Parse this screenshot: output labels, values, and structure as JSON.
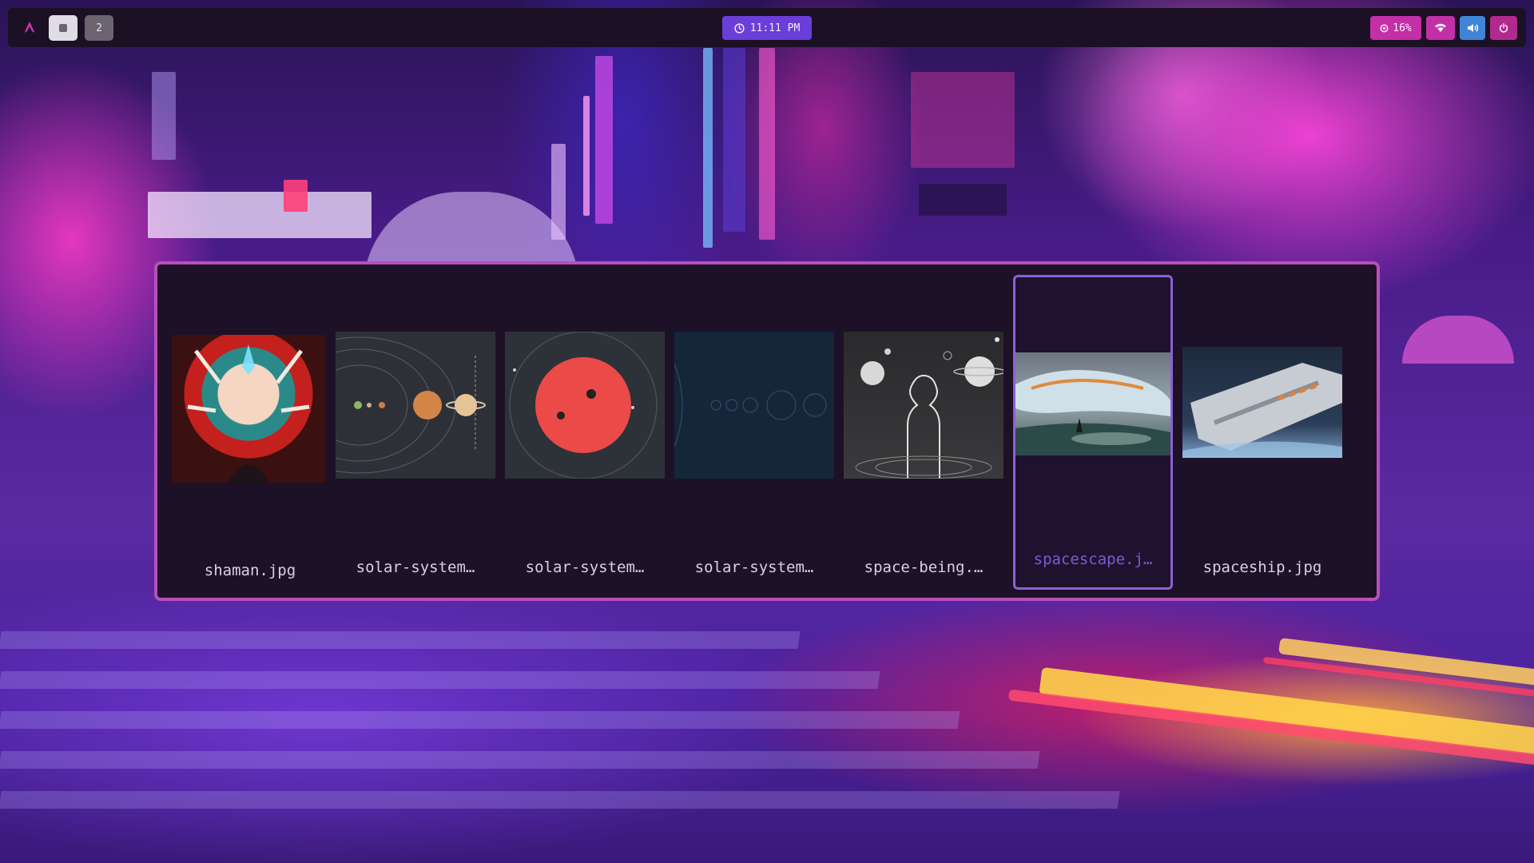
{
  "topbar": {
    "logo_icon": "arch-logo-icon",
    "workspaces": [
      {
        "label": "",
        "active": true
      },
      {
        "label": "2",
        "active": false
      }
    ],
    "clock": {
      "time": "11:11 PM",
      "icon": "clock-icon"
    },
    "tray": {
      "cpu": {
        "value": "16%",
        "icon": "cpu-icon"
      },
      "wifi_icon": "wifi-icon",
      "volume_icon": "volume-icon",
      "power_icon": "power-icon"
    }
  },
  "launcher": {
    "selected_index": 5,
    "items": [
      {
        "name": "shaman.jpg"
      },
      {
        "name": "solar-system…"
      },
      {
        "name": "solar-system…"
      },
      {
        "name": "solar-system…"
      },
      {
        "name": "space-being.…"
      },
      {
        "name": "spacescape.j…"
      },
      {
        "name": "spaceship.jpg"
      }
    ]
  },
  "colors": {
    "bar_bg": "#1c1024",
    "clock_bg": "#6a3ed8",
    "tray_pink": "#c32fa6",
    "tray_blue": "#3f84d6",
    "launcher_border": "#b84fbd",
    "selected_border": "#8f5fd8",
    "selected_text": "#7b5cd6"
  }
}
